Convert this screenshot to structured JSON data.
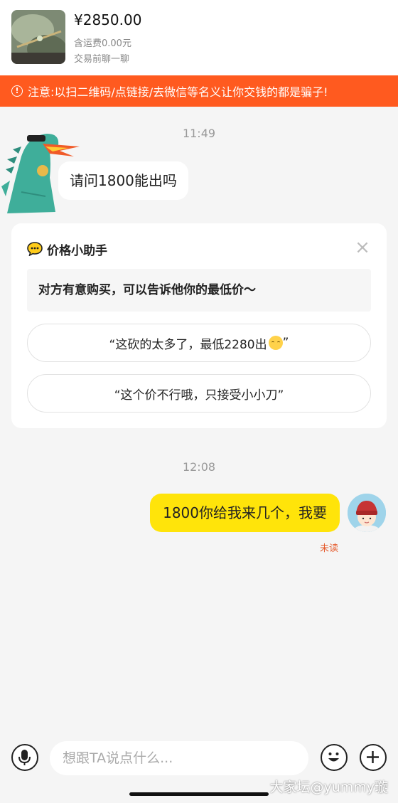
{
  "header": {
    "price": "¥2850.00",
    "shipping": "含运费0.00元",
    "chat_first": "交易前聊一聊"
  },
  "warning": {
    "text": "注意:以扫二维码/点链接/去微信等名义让你交钱的都是骗子!",
    "icon": "alert-circle-icon",
    "color": "#ff5a1f"
  },
  "messages": {
    "time1": "11:49",
    "incoming": "请问1800能出吗",
    "time2": "12:08",
    "outgoing": "1800你给我来几个，我要",
    "outgoing_status": "未读"
  },
  "assistant": {
    "title": "价格小助手",
    "tip": "对方有意购买，可以告诉他你的最低价～",
    "reply1": "“这砍的太多了，最低2280出",
    "reply1_end": "”",
    "reply2": "“这个价不行哦，只接受小小刀”",
    "close_symbol": "×"
  },
  "input": {
    "placeholder": "想跟TA说点什么..."
  },
  "watermark": "大家坛@yummy璇",
  "colors": {
    "accent_yellow": "#ffe40a",
    "unread_red": "#e55a2b"
  }
}
